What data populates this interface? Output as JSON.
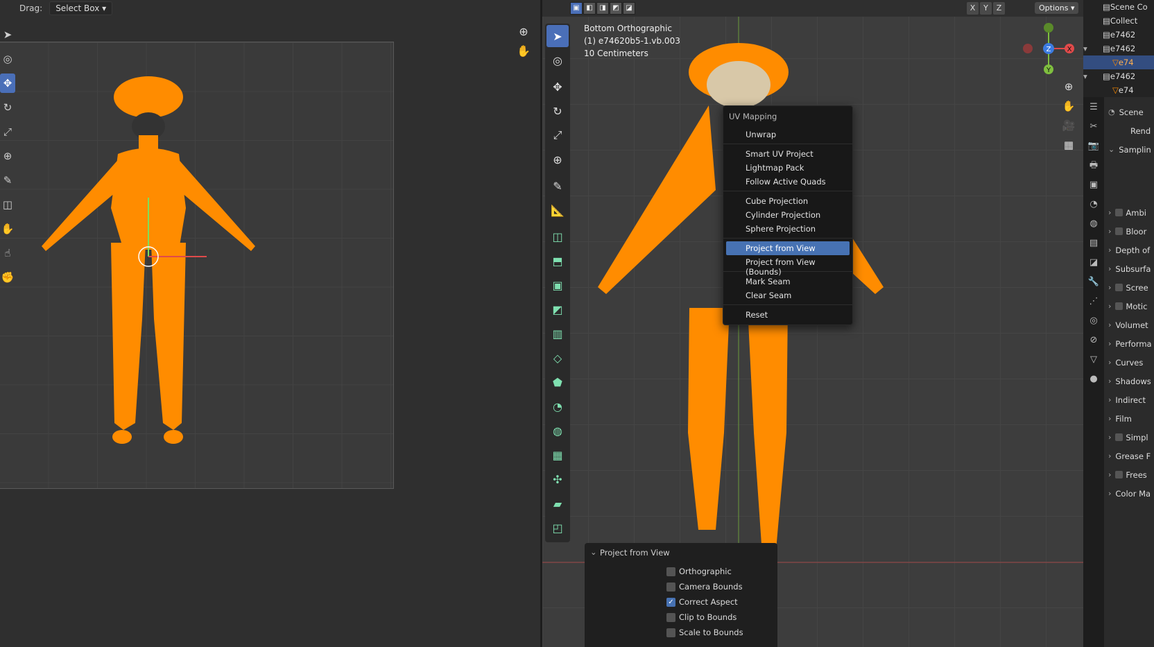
{
  "uv_editor": {
    "drag_label": "Drag:",
    "drag_value": "Select Box",
    "tools": [
      "cursor-icon",
      "cursor-target-icon",
      "move-icon",
      "rotate-icon",
      "scale-icon",
      "transform-icon",
      "annotate-icon",
      "rip-icon",
      "grab-icon",
      "relax-icon",
      "pinch-icon"
    ],
    "nav_icons": [
      "zoom-icon",
      "pan-icon"
    ]
  },
  "viewport": {
    "view_name": "Bottom Orthographic",
    "object_name": "(1) e74620b5-1.vb.003",
    "scale": "10 Centimeters",
    "axes": [
      "X",
      "Y",
      "Z"
    ],
    "options_label": "Options",
    "gizmo": {
      "x": "X",
      "y": "Y",
      "z": "Z"
    }
  },
  "uv_menu": {
    "title": "UV Mapping",
    "items": [
      "Unwrap",
      "Smart UV Project",
      "Lightmap Pack",
      "Follow Active Quads",
      "Cube Projection",
      "Cylinder Projection",
      "Sphere Projection",
      "Project from View",
      "Project from View (Bounds)",
      "Mark Seam",
      "Clear Seam",
      "Reset"
    ],
    "highlighted": "Project from View"
  },
  "redo_panel": {
    "title": "Project from View",
    "options": [
      {
        "label": "Orthographic",
        "checked": false
      },
      {
        "label": "Camera Bounds",
        "checked": false
      },
      {
        "label": "Correct Aspect",
        "checked": true
      },
      {
        "label": "Clip to Bounds",
        "checked": false
      },
      {
        "label": "Scale to Bounds",
        "checked": false
      }
    ]
  },
  "outliner": {
    "rows": [
      "Scene Co",
      "Collect",
      "e7462",
      "e7462",
      "e74",
      "e7462",
      "e74"
    ]
  },
  "properties": {
    "scene_label": "Scene",
    "render_label": "Rend",
    "sections": [
      "Samplin",
      "Ambi",
      "Bloor",
      "Depth of",
      "Subsurfa",
      "Scree",
      "Motic",
      "Volumet",
      "Performa",
      "Curves",
      "Shadows",
      "Indirect",
      "Film",
      "Simpl",
      "Grease F",
      "Frees",
      "Color Ma"
    ]
  },
  "colors": {
    "mesh": "#ff8c00",
    "accent": "#4772b3"
  }
}
